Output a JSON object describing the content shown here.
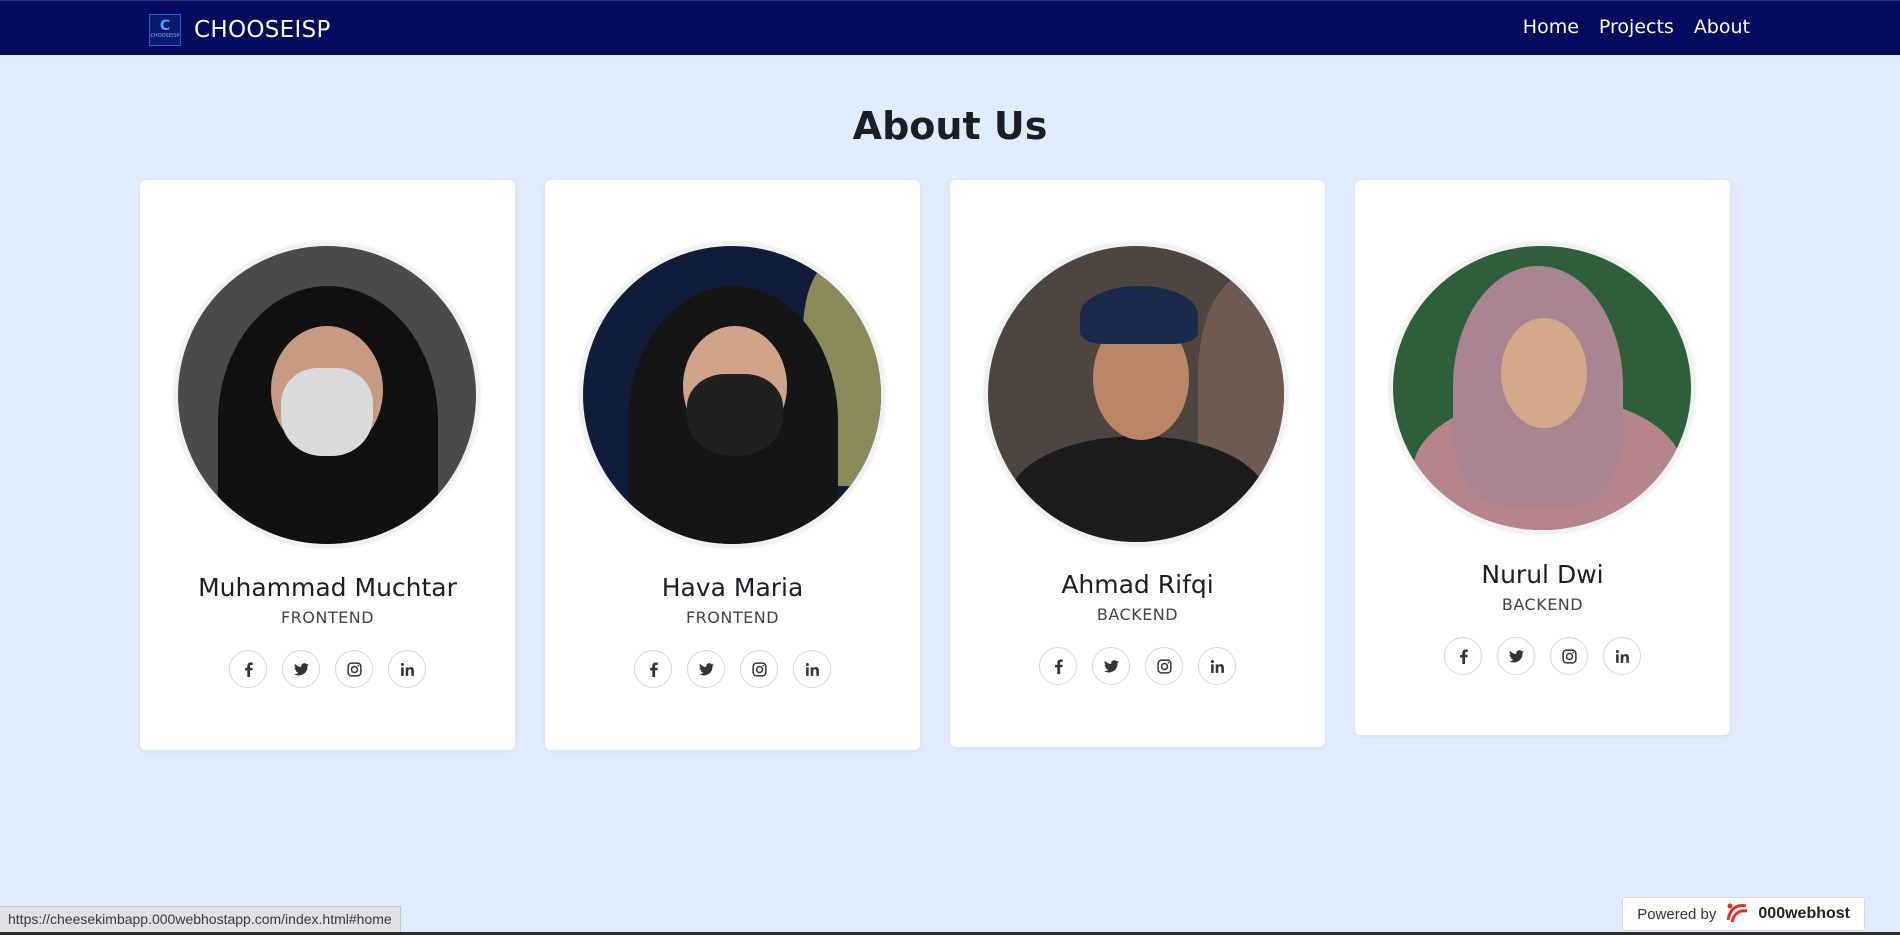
{
  "navbar": {
    "brand_name": "CHOOSEISP",
    "logo_letter": "C",
    "logo_sub": "CHOOSEISP",
    "links": [
      "Home",
      "Projects",
      "About"
    ]
  },
  "page": {
    "title": "About Us"
  },
  "members": [
    {
      "name": "Muhammad Muchtar",
      "role": "FRONTEND"
    },
    {
      "name": "Hava Maria",
      "role": "FRONTEND"
    },
    {
      "name": "Ahmad Rifqi",
      "role": "BACKEND"
    },
    {
      "name": "Nurul Dwi",
      "role": "BACKEND"
    }
  ],
  "social_icons": [
    "facebook-icon",
    "twitter-icon",
    "instagram-icon",
    "linkedin-icon"
  ],
  "status_bar": {
    "url": "https://cheesekimbapp.000webhostapp.com/index.html#home"
  },
  "powered_by": {
    "label": "Powered by",
    "brand": "000webhost"
  },
  "colors": {
    "navbar": "#040a5e",
    "background": "#e0ebfd",
    "card": "#ffffff"
  }
}
